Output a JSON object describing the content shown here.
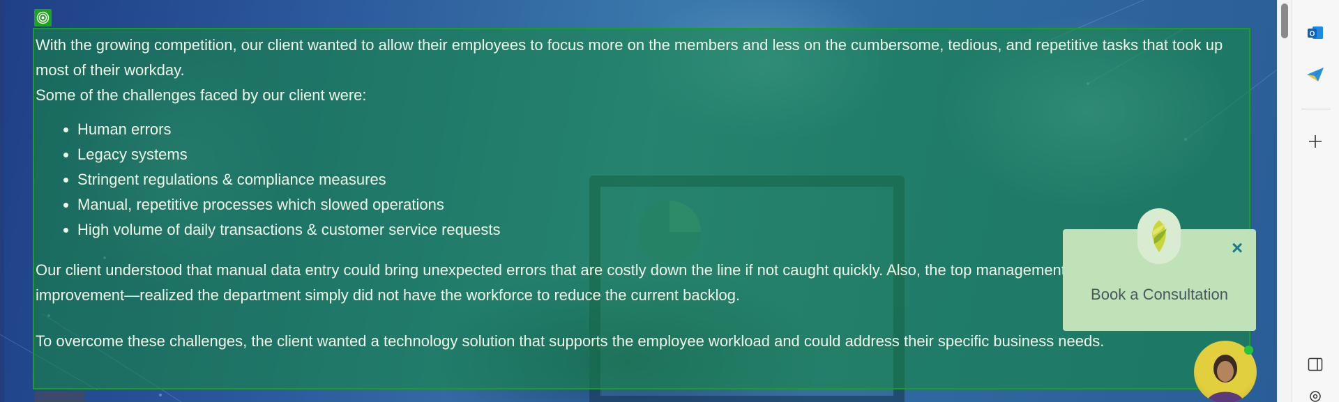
{
  "page": {
    "paragraphs": [
      "With the growing competition, our client wanted to allow their employees to focus more on the members and less on the cumbersome, tedious, and repetitive tasks that took up most of their workday.",
      "Some of the challenges faced by our client were:",
      "Our client understood that manual data entry could bring unexpected errors that are costly down the line if not caught quickly. Also, the top management, committed to process improvement—realized the department simply did not have the workforce to reduce the current backlog.",
      "To overcome these challenges, the client wanted a technology solution that supports the employee workload and could address their specific business needs."
    ],
    "challenges": [
      "Human errors",
      "Legacy systems",
      "Stringent regulations & compliance measures",
      "Manual, repetitive processes which slowed operations",
      "High volume of daily transactions & customer service requests"
    ]
  },
  "popup": {
    "cta_label": "Book a Consultation",
    "close_label": "×"
  },
  "sidebar": {
    "icons": [
      "outlook-icon",
      "send-icon",
      "add-icon",
      "split-view-icon",
      "settings-icon"
    ]
  },
  "colors": {
    "highlight_fill": "#148c3c",
    "highlight_border": "#1aa01f",
    "popup_bg": "#bfe2b8",
    "close_color": "#1a7a8c"
  }
}
